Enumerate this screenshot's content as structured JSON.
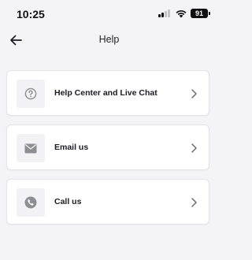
{
  "status_bar": {
    "time": "10:25",
    "battery_level": "91",
    "icons": [
      "cellular-signal-icon",
      "wifi-icon",
      "battery-icon"
    ]
  },
  "header": {
    "title": "Help",
    "back_icon": "arrow-left-icon"
  },
  "options": [
    {
      "label": "Help Center and Live Chat",
      "icon": "question-circle-icon"
    },
    {
      "label": "Email us",
      "icon": "envelope-icon"
    },
    {
      "label": "Call us",
      "icon": "phone-icon"
    }
  ],
  "colors": {
    "background": "#f4f4f6",
    "card": "#ffffff",
    "icon_box": "#f2f2f4",
    "icon": "#8d8d94",
    "text": "#1b1b24"
  }
}
